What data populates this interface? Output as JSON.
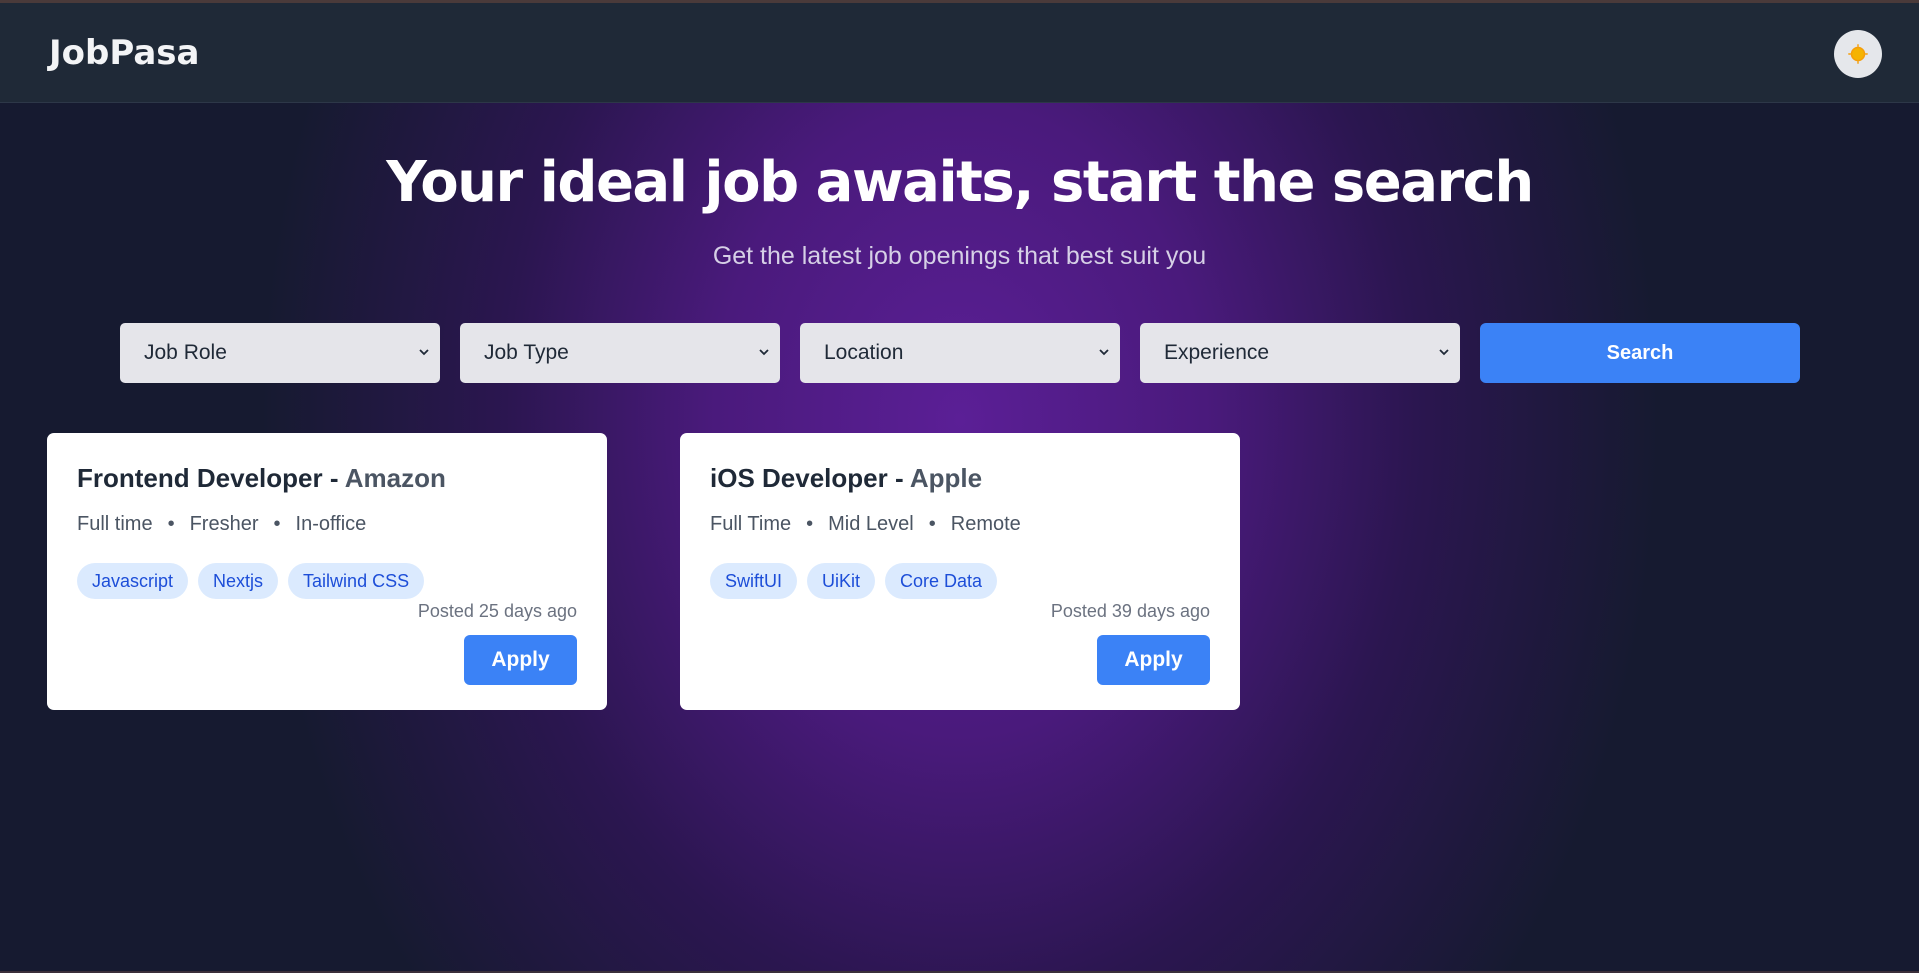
{
  "navbar": {
    "brand": "JobPasa",
    "theme_toggle_icon": "sun-icon"
  },
  "hero": {
    "title": "Your ideal job awaits, start the search",
    "subtitle": "Get the latest job openings that best suit you"
  },
  "filters": {
    "job_role": "Job Role",
    "job_type": "Job Type",
    "location": "Location",
    "experience": "Experience",
    "search_label": "Search"
  },
  "jobs": [
    {
      "role": "Frontend Developer",
      "separator": " - ",
      "company": "Amazon",
      "type": "Full time",
      "level": "Fresher",
      "mode": "In-office",
      "skills": [
        "Javascript",
        "Nextjs",
        "Tailwind CSS"
      ],
      "posted": "Posted 25 days ago",
      "apply_label": "Apply"
    },
    {
      "role": "iOS Developer",
      "separator": " - ",
      "company": "Apple",
      "type": "Full Time",
      "level": "Mid Level",
      "mode": "Remote",
      "skills": [
        "SwiftUI",
        "UiKit",
        "Core Data"
      ],
      "posted": "Posted 39 days ago",
      "apply_label": "Apply"
    }
  ],
  "meta_separator": "•",
  "colors": {
    "accent": "#3b82f6",
    "navbar": "#1f2937",
    "tag_bg": "#dbeafe",
    "tag_text": "#1d4ed8",
    "sun": "#f5b301"
  }
}
